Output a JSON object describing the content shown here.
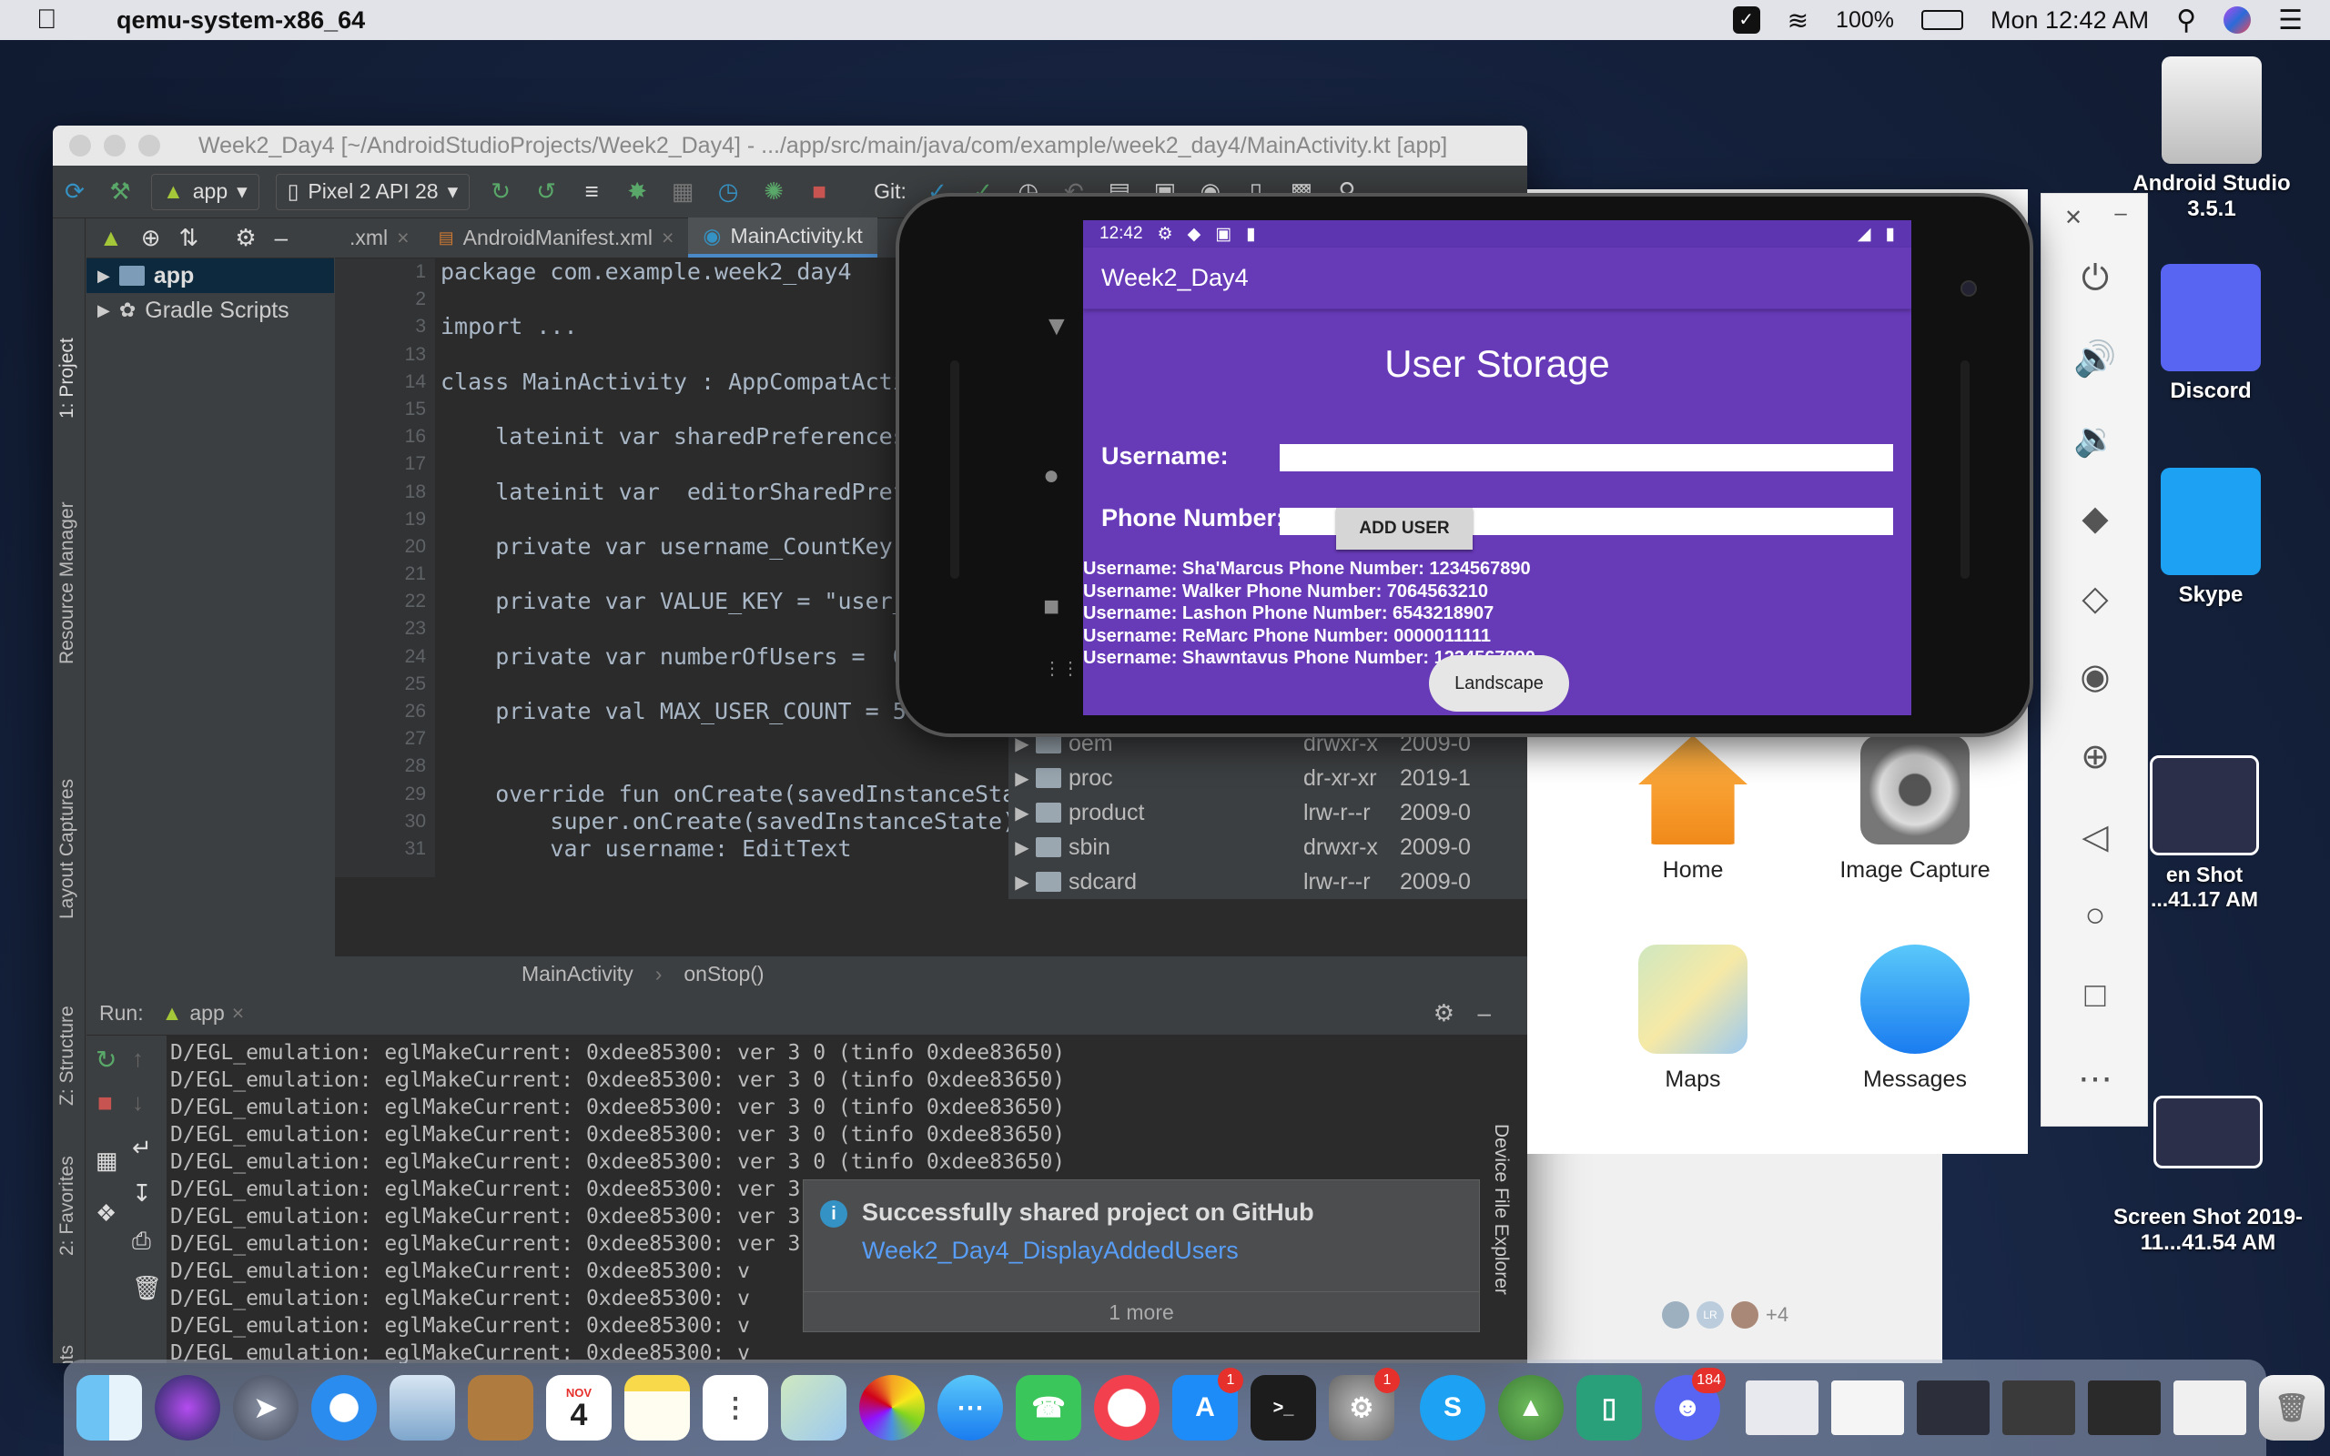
{
  "menubar": {
    "app_name": "qemu-system-x86_64",
    "battery": "100%",
    "clock": "Mon 12:42 AM"
  },
  "desktop": {
    "icons": [
      {
        "label": "Android Studio 3.5.1"
      },
      {
        "label": "Discord"
      },
      {
        "label": "Skype"
      },
      {
        "label": "en Shot ...41.17 AM"
      },
      {
        "label": "Screen Shot 2019-11...41.54 AM"
      }
    ]
  },
  "studio": {
    "title": "Week2_Day4 [~/AndroidStudioProjects/Week2_Day4] - .../app/src/main/java/com/example/week2_day4/MainActivity.kt [app]",
    "run_config": "app",
    "device": "Pixel 2 API 28",
    "git_label": "Git:",
    "left_tabs": [
      "1: Project",
      "Resource Manager",
      "Layout Captures",
      "Z: Structure",
      "2: Favorites",
      "uild Variants"
    ],
    "project_tree": [
      {
        "label": "app"
      },
      {
        "label": "Gradle Scripts"
      }
    ],
    "tabs": [
      {
        "label": ".xml"
      },
      {
        "label": "AndroidManifest.xml"
      },
      {
        "label": "MainActivity.kt"
      }
    ],
    "line_numbers": [
      "1",
      "2",
      "3",
      "13",
      "14",
      "15",
      "16",
      "17",
      "18",
      "19",
      "20",
      "21",
      "22",
      "23",
      "24",
      "25",
      "26",
      "27",
      "28",
      "29",
      "30",
      "31"
    ],
    "code_lines": [
      "package com.example.week2_day4",
      "",
      "import ...",
      "",
      "class MainActivity : AppCompatActi",
      "",
      "    lateinit var sharedPreferences",
      "",
      "    lateinit var  editorSharedPref",
      "",
      "    private var username_CountKey:",
      "",
      "    private var VALUE_KEY = \"user_",
      "",
      "    private var numberOfUsers =  0",
      "",
      "    private val MAX_USER_COUNT = 5",
      "",
      "",
      "    override fun onCreate(savedInstanceSta",
      "        super.onCreate(savedInstanceState)",
      "        var username: EditText"
    ],
    "breadcrumb": [
      "MainActivity",
      "onStop()"
    ],
    "device_files": [
      {
        "name": "oem",
        "perm": "drwxr-x",
        "date": "2009-0"
      },
      {
        "name": "proc",
        "perm": "dr-xr-xr",
        "date": "2019-1"
      },
      {
        "name": "product",
        "perm": "lrw-r--r",
        "date": "2009-0"
      },
      {
        "name": "sbin",
        "perm": "drwxr-x",
        "date": "2009-0"
      },
      {
        "name": "sdcard",
        "perm": "lrw-r--r",
        "date": "2009-0"
      }
    ],
    "device_file_explorer_label": "Device File Explorer",
    "run_label": "Run:",
    "run_tab": "app",
    "console_lines": [
      "D/EGL_emulation: eglMakeCurrent: 0xdee85300: ver 3 0 (tinfo 0xdee83650)",
      "D/EGL_emulation: eglMakeCurrent: 0xdee85300: ver 3 0 (tinfo 0xdee83650)",
      "D/EGL_emulation: eglMakeCurrent: 0xdee85300: ver 3 0 (tinfo 0xdee83650)",
      "D/EGL_emulation: eglMakeCurrent: 0xdee85300: ver 3 0 (tinfo 0xdee83650)",
      "D/EGL_emulation: eglMakeCurrent: 0xdee85300: ver 3 0 (tinfo 0xdee83650)",
      "D/EGL_emulation: eglMakeCurrent: 0xdee85300: ver 3 0 (tinfo 0xdee83650)",
      "D/EGL_emulation: eglMakeCurrent: 0xdee85300: ver 3 0 (tinfo 0xdee83650)",
      "D/EGL_emulation: eglMakeCurrent: 0xdee85300: ver 3 0 (tinfo 0xdee83650)",
      "D/EGL_emulation: eglMakeCurrent: 0xdee85300: v",
      "D/EGL_emulation: eglMakeCurrent: 0xdee85300: v",
      "D/EGL_emulation: eglMakeCurrent: 0xdee85300: v",
      "D/EGL_emulation: eglMakeCurrent: 0xdee85300: v",
      "D/EGL_emulation: eglMakeCurrent: 0xdee85300: v"
    ],
    "notification": {
      "title": "Successfully shared project on GitHub",
      "link": "Week2_Day4_DisplayAddedUsers",
      "more": "1 more"
    }
  },
  "phone": {
    "status_time": "12:42",
    "app_bar_title": "Week2_Day4",
    "heading": "User Storage",
    "username_label": "Username:",
    "phone_label": "Phone Number:",
    "add_button": "ADD USER",
    "users": [
      "Username:  Sha'Marcus Phone Number:  1234567890",
      "Username:  Walker Phone Number:  7064563210",
      "Username:  Lashon Phone Number:  6543218907",
      "Username:  ReMarc Phone Number:  0000011111",
      "Username:  Shawntavus Phone Number:  1234567890"
    ],
    "toast": "Landscape"
  },
  "apps_panel": {
    "apps": [
      {
        "label": "Home"
      },
      {
        "label": "Image Capture"
      },
      {
        "label": "Maps"
      },
      {
        "label": "Messages"
      }
    ],
    "avatar_initials": "LR",
    "avatars_more": "+4"
  },
  "dock": {
    "calendar_month": "NOV",
    "calendar_day": "4",
    "badges": {
      "app_store": "1",
      "system_prefs": "1",
      "discord": "184"
    }
  }
}
